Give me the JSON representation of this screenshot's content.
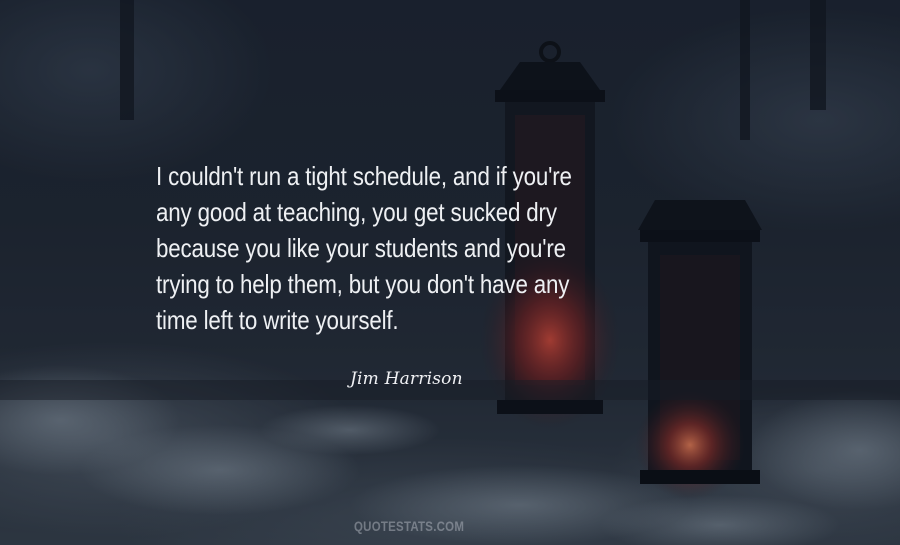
{
  "quote": {
    "text": "I couldn't run a tight schedule, and if you're\nany good at teaching, you get sucked dry\nbecause you like your students and you're\ntrying to help them, but you don't have any\ntime left to write yourself."
  },
  "author": {
    "name": "Jim Harrison"
  },
  "watermark": {
    "text": "QUOTESTATS.COM"
  },
  "colors": {
    "background": "#1d2430",
    "text": "#eef0f3",
    "lantern_glow": "#d8453c"
  }
}
